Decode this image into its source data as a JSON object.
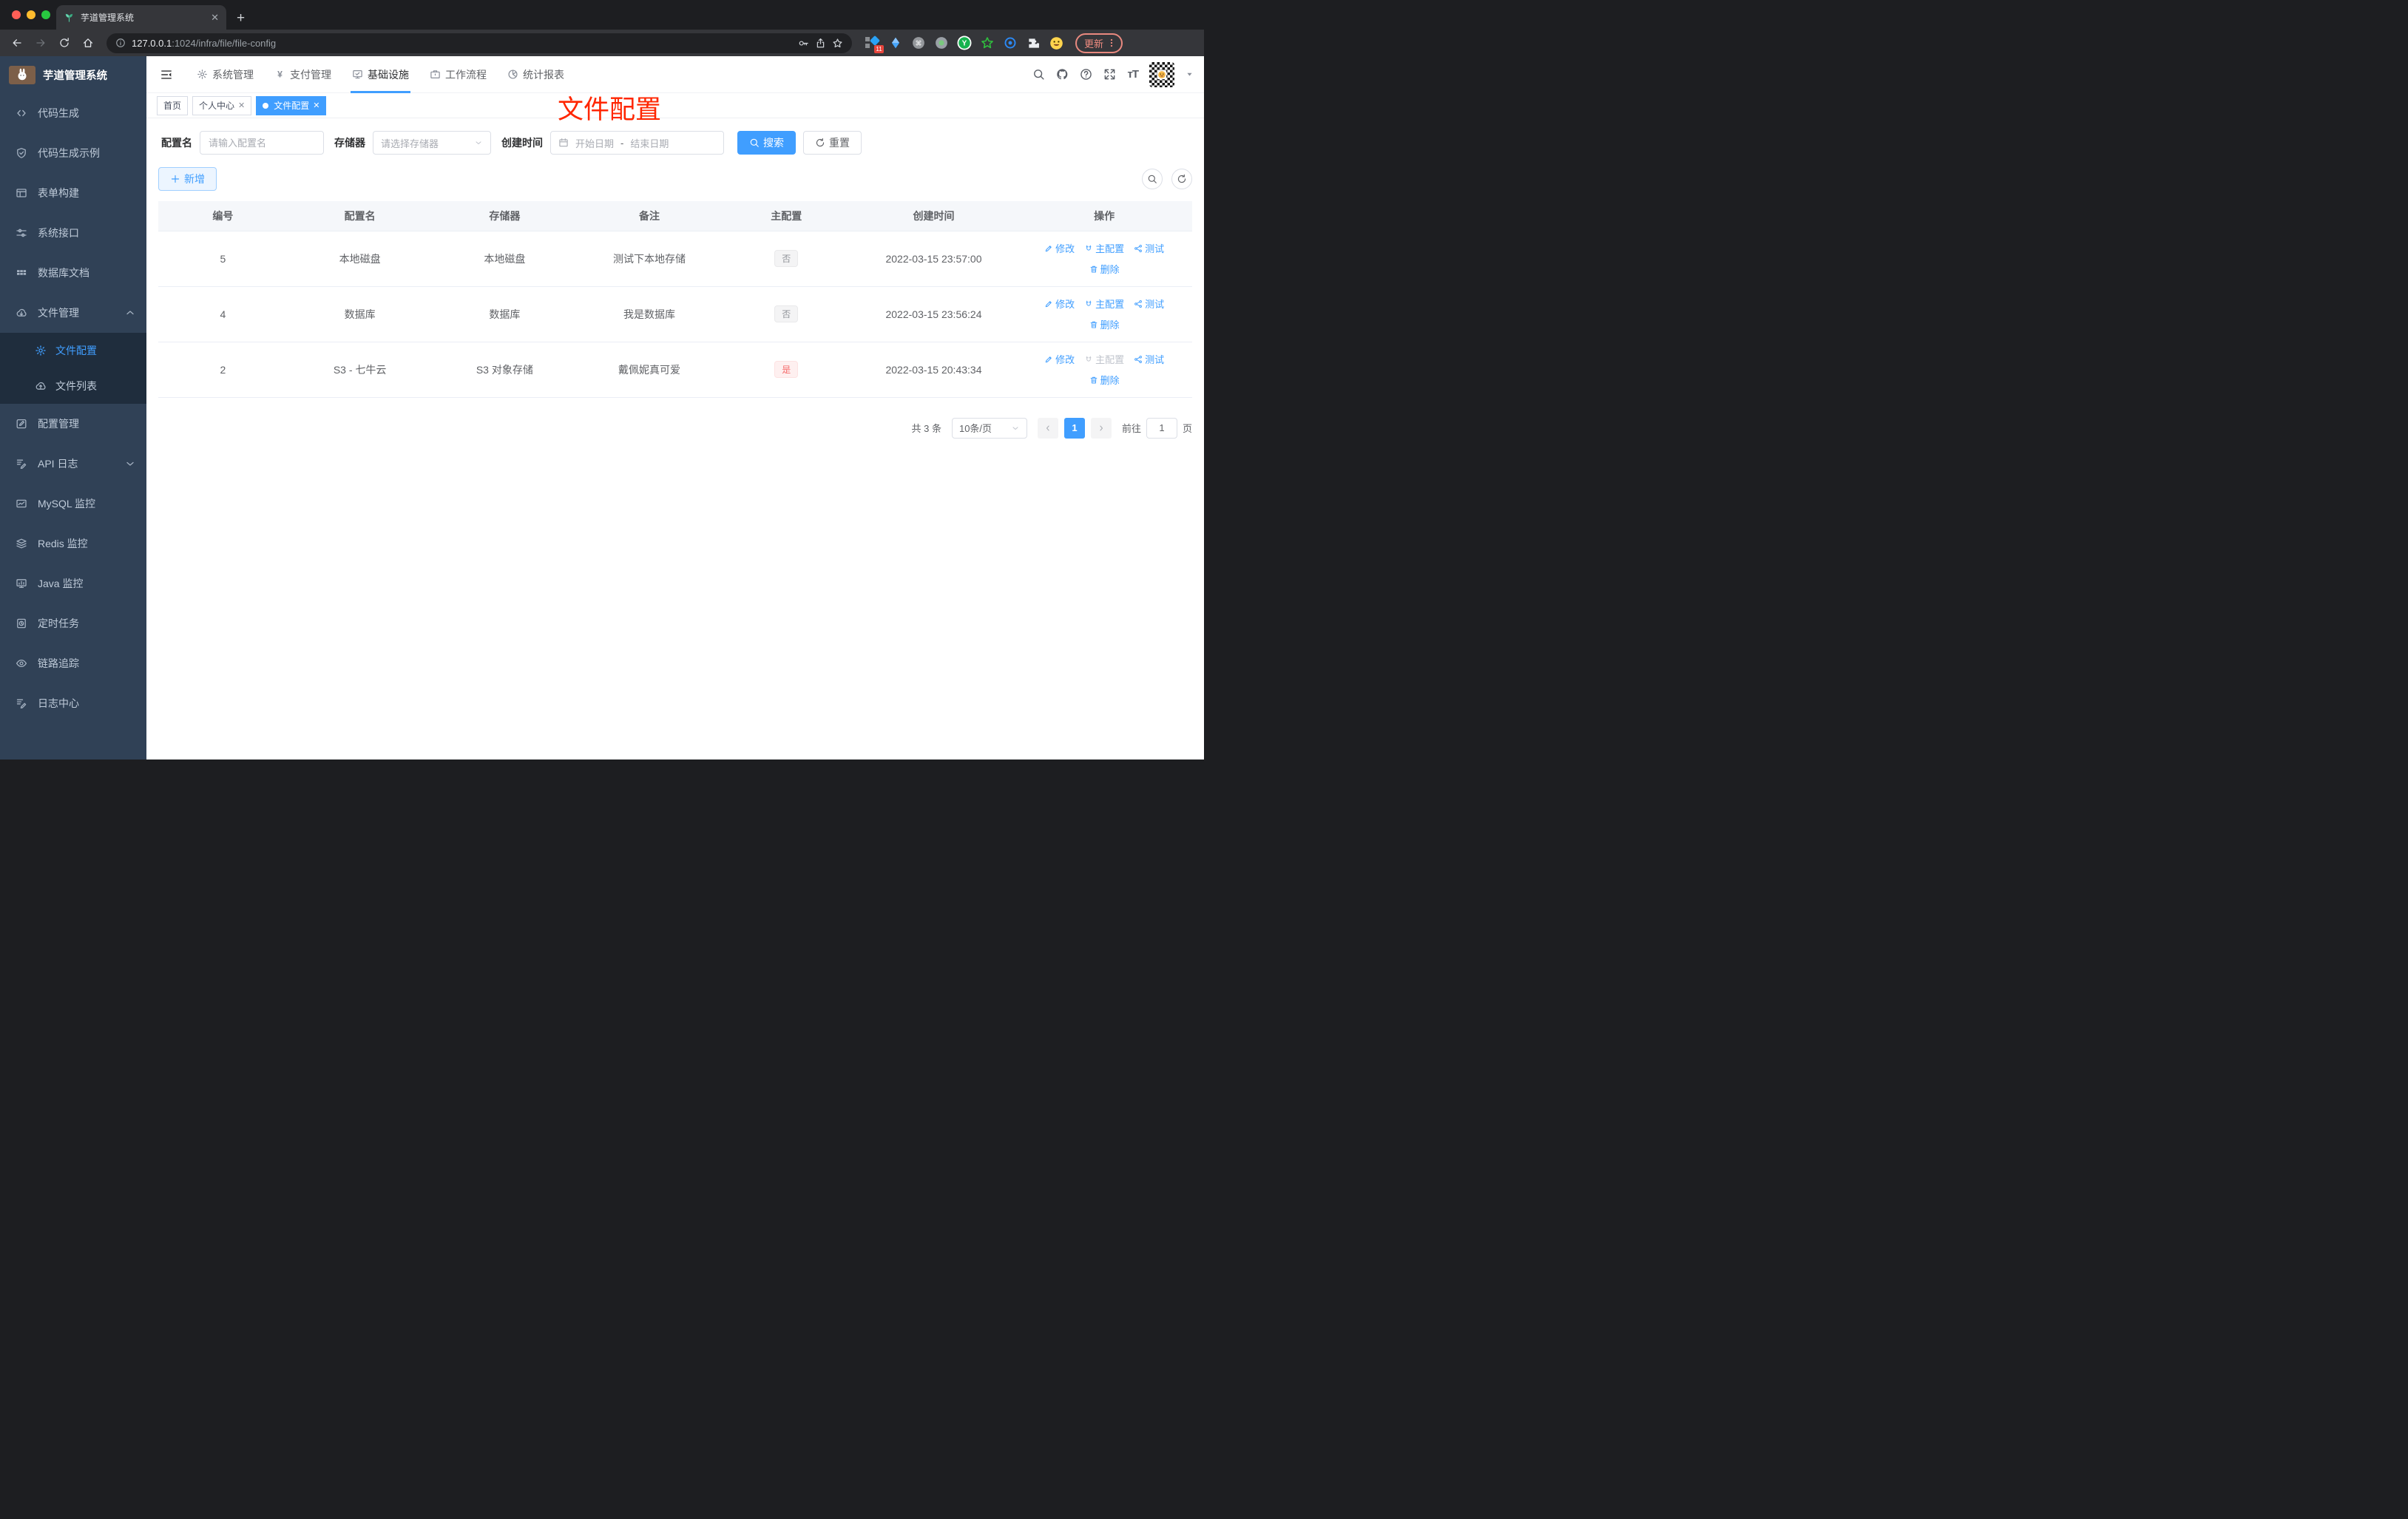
{
  "browser": {
    "tab_title": "芋道管理系统",
    "new_tab_label": "+",
    "url_host": "127.0.0.1",
    "url_rest": ":1024/infra/file/file-config",
    "extension_badge": "11",
    "update_label": "更新"
  },
  "sidebar": {
    "app_title": "芋道管理系统",
    "items": [
      {
        "id": "code-gen",
        "icon": "code",
        "label": "代码生成"
      },
      {
        "id": "code-example",
        "icon": "shield",
        "label": "代码生成示例"
      },
      {
        "id": "form-builder",
        "icon": "form",
        "label": "表单构建"
      },
      {
        "id": "system-api",
        "icon": "sliders",
        "label": "系统接口"
      },
      {
        "id": "db-doc",
        "icon": "grid",
        "label": "数据库文档"
      },
      {
        "id": "file-manage",
        "icon": "cloud-down",
        "label": "文件管理",
        "chevron": "up",
        "children": [
          {
            "id": "file-config",
            "icon": "gear",
            "label": "文件配置",
            "active": true
          },
          {
            "id": "file-list",
            "icon": "cloud-up",
            "label": "文件列表"
          }
        ]
      },
      {
        "id": "config-manage",
        "icon": "edit-square",
        "label": "配置管理"
      },
      {
        "id": "api-log",
        "icon": "log",
        "label": "API 日志",
        "chevron": "down"
      },
      {
        "id": "mysql-monitor",
        "icon": "chart",
        "label": "MySQL 监控"
      },
      {
        "id": "redis-monitor",
        "icon": "layers",
        "label": "Redis 监控"
      },
      {
        "id": "java-monitor",
        "icon": "monitor",
        "label": "Java 监控"
      },
      {
        "id": "cron-job",
        "icon": "timer",
        "label": "定时任务"
      },
      {
        "id": "trace",
        "icon": "eye",
        "label": "链路追踪"
      },
      {
        "id": "log-center",
        "icon": "log",
        "label": "日志中心"
      }
    ]
  },
  "topnav": {
    "items": [
      {
        "id": "system",
        "icon": "gear",
        "label": "系统管理"
      },
      {
        "id": "payment",
        "icon": "yen",
        "label": "支付管理"
      },
      {
        "id": "infra",
        "icon": "infra",
        "label": "基础设施",
        "active": true
      },
      {
        "id": "workflow",
        "icon": "work",
        "label": "工作流程"
      },
      {
        "id": "report",
        "icon": "stats",
        "label": "统计报表"
      }
    ]
  },
  "tags": [
    {
      "id": "home",
      "label": "首页",
      "closable": false,
      "active": false
    },
    {
      "id": "profile",
      "label": "个人中心",
      "closable": true,
      "active": false
    },
    {
      "id": "file-config",
      "label": "文件配置",
      "closable": true,
      "active": true
    }
  ],
  "annotation": {
    "text": "文件配置",
    "color": "#ff2600"
  },
  "filters": {
    "name_label": "配置名",
    "name_placeholder": "请输入配置名",
    "storage_label": "存储器",
    "storage_placeholder": "请选择存储器",
    "time_label": "创建时间",
    "start_placeholder": "开始日期",
    "range_separator": "-",
    "end_placeholder": "结束日期",
    "search_label": "搜索",
    "reset_label": "重置"
  },
  "toolbar": {
    "add_label": "新增"
  },
  "table": {
    "columns": [
      "编号",
      "配置名",
      "存储器",
      "备注",
      "主配置",
      "创建时间",
      "操作"
    ],
    "actions": {
      "edit": "修改",
      "master": "主配置",
      "test": "测试",
      "delete": "删除"
    },
    "rows": [
      {
        "id": "5",
        "name": "本地磁盘",
        "storage": "本地磁盘",
        "remark": "测试下本地存储",
        "master": "否",
        "master_type": "info",
        "created": "2022-03-15 23:57:00",
        "master_disabled": false
      },
      {
        "id": "4",
        "name": "数据库",
        "storage": "数据库",
        "remark": "我是数据库",
        "master": "否",
        "master_type": "info",
        "created": "2022-03-15 23:56:24",
        "master_disabled": false
      },
      {
        "id": "2",
        "name": "S3 - 七牛云",
        "storage": "S3 对象存储",
        "remark": "戴佩妮真可爱",
        "master": "是",
        "master_type": "danger",
        "created": "2022-03-15 20:43:34",
        "master_disabled": true
      }
    ]
  },
  "pagination": {
    "total": "共 3 条",
    "size": "10条/页",
    "page": "1",
    "goto": "前往",
    "goto_value": "1",
    "unit": "页"
  },
  "colors": {
    "accent": "#409eff",
    "danger": "#f56c6c",
    "annotation": "#ff2600",
    "sidebar_bg": "#304156",
    "submenu_bg": "#1f2d3d"
  }
}
